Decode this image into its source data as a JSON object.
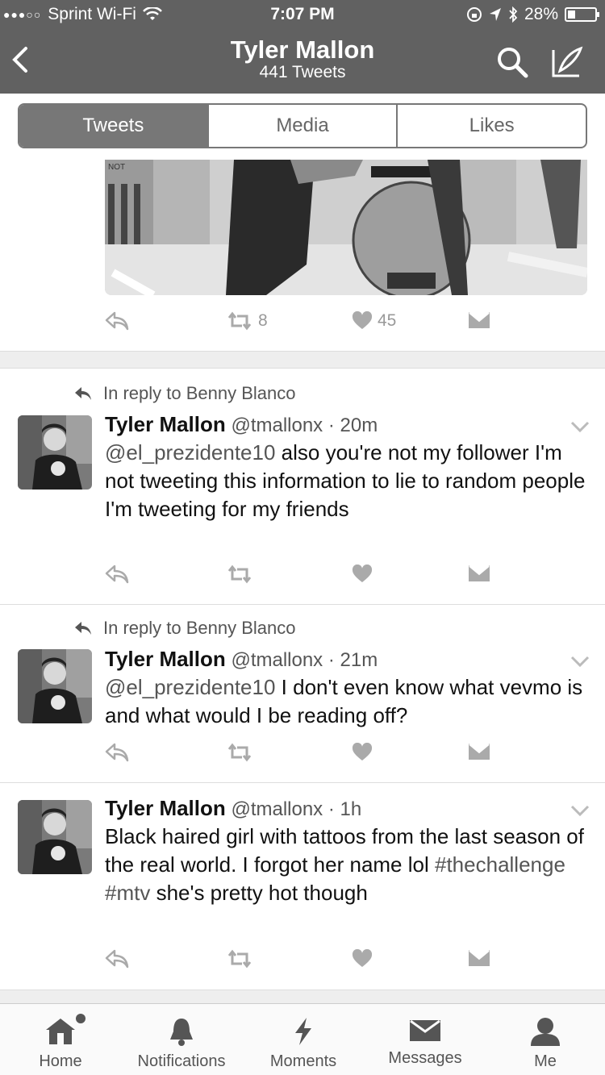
{
  "status_bar": {
    "carrier": "Sprint Wi-Fi",
    "time": "7:07 PM",
    "battery": "28%",
    "battery_level": 0.28
  },
  "header": {
    "title": "Tyler Mallon",
    "subtitle": "441 Tweets"
  },
  "tabs": [
    "Tweets",
    "Media",
    "Likes"
  ],
  "first_tweet": {
    "retweets": "8",
    "likes": "45",
    "photo_text": "NOT"
  },
  "tweets": [
    {
      "reply_to": "In reply to Benny Blanco",
      "name": "Tyler Mallon",
      "handle": "@tmallonx",
      "time": "· 20m",
      "mention": "@el_prezidente10",
      "text": "also you're not my follower I'm not tweeting this information to lie to random people I'm tweeting for my friends"
    },
    {
      "reply_to": "In reply to Benny Blanco",
      "name": "Tyler Mallon",
      "handle": "@tmallonx",
      "time": "· 21m",
      "mention": "@el_prezidente10",
      "text": "I don't even know what vevmo is and what would I be reading off?"
    },
    {
      "name": "Tyler Mallon",
      "handle": "@tmallonx",
      "time": "· 1h",
      "text_a": "Black haired girl with tattoos from the last season of the real world. I forgot her name lol",
      "hashtag1": "#thechallenge",
      "hashtag2": "#mtv",
      "text_b": "she's pretty hot though"
    }
  ],
  "bottom_tabs": {
    "home": "Home",
    "notifications": "Notifications",
    "moments": "Moments",
    "messages": "Messages",
    "me": "Me"
  }
}
